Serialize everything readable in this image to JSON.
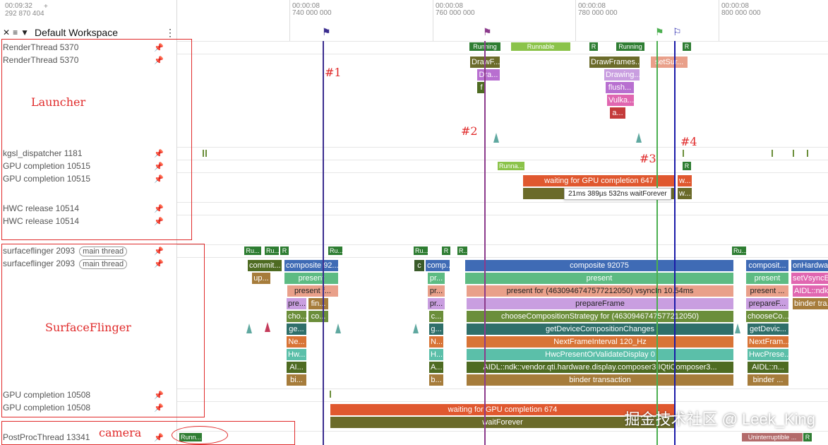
{
  "header": {
    "time": "00:09:32",
    "plus": "+",
    "ns": "292 870 404",
    "workspace_title": "Default Workspace",
    "ruler": [
      {
        "t": "00:00:08",
        "ns": "740 000 000"
      },
      {
        "t": "00:00:08",
        "ns": "760 000 000"
      },
      {
        "t": "00:00:08",
        "ns": "780 000 000"
      },
      {
        "t": "00:00:08",
        "ns": "800 000 000"
      }
    ]
  },
  "tracks": {
    "t0": "RenderThread 5370",
    "t1": "RenderThread 5370",
    "t2": "kgsl_dispatcher 1181",
    "t3": "GPU completion 10515",
    "t4": "GPU completion 10515",
    "t5": "HWC release 10514",
    "t6": "HWC release 10514",
    "t7": "surfaceflinger 2093",
    "t7pill": "main thread",
    "t8": "surfaceflinger 2093",
    "t8pill": "main thread",
    "t9": "GPU completion 10508",
    "t10": "GPU completion 10508",
    "t11": "PostProcThread 13341"
  },
  "annotations": {
    "launcher": "Launcher",
    "surfaceflinger": "SurfaceFlinger",
    "camera": "camera",
    "m1": "#1",
    "m2": "#2",
    "m3": "#3",
    "m4": "#4"
  },
  "slices": {
    "rt_running1": "Running",
    "rt_runnable": "Runnable",
    "rt_r1": "R",
    "rt_running2": "Running",
    "rt_r2": "R",
    "rt_drawf": "DrawF...",
    "rt_dra": "Dra...",
    "rt_f": "f",
    "rt_drawframes": "DrawFrames...",
    "rt_setsur": "setSur...",
    "rt_drawing": "Drawing...",
    "rt_flush": "flush...",
    "rt_vulka": "Vulka...",
    "rt_a": "a...",
    "gpu_runna": "Runna...",
    "gpu_r": "R",
    "gpu_wait647": "waiting for GPU completion 647",
    "gpu_w1": "w...",
    "gpu_w2": "w...",
    "tooltip": "21ms 389µs 532ns waitForever",
    "sf_ru1": "Ru...",
    "sf_ru2": "Ru...",
    "sf_r1": "R",
    "sf_ru3": "Ru...",
    "sf_ru4": "Ru...",
    "sf_r2": "R",
    "sf_r3": "R...",
    "sf_ru5": "Ru...",
    "sf_commit": "commit...",
    "sf_composite1": "composite 92...",
    "sf_c": "c",
    "sf_comp": "comp...",
    "sf_composite_main": "composite 92075",
    "sf_composite2": "composit...",
    "sf_onhardware": "onHardwa...",
    "sf_up": "up...",
    "sf_present1": "present",
    "sf_pr1": "pr...",
    "sf_present_main": "present",
    "sf_present2": "present",
    "sf_setvsync": "setVsyncE...",
    "sf_presentf": "present f...",
    "sf_pr2": "pr...",
    "sf_presentfor": "present for  (4630946747577212050) vsyncIn 10.54ms",
    "sf_present3": "present ...",
    "sf_aidlndk": "AIDL::ndk...",
    "sf_pre": "pre...",
    "sf_fin": "fin...",
    "sf_pr3": "pr...",
    "sf_prepareframe": "prepareFrame",
    "sf_preparef": "prepareF...",
    "sf_bindertra": "binder tra...",
    "sf_cho": "cho...",
    "sf_co": "co...",
    "sf_c2": "c...",
    "sf_choose": "chooseCompositionStrategy for  (4630946747577212050)",
    "sf_chooseco": "chooseCo...",
    "sf_ge": "ge...",
    "sf_g": "g...",
    "sf_getdev": "getDeviceCompositionChanges",
    "sf_getdevic": "getDevic...",
    "sf_ne": "Ne...",
    "sf_n": "N...",
    "sf_nextframe": "NextFrameInterval 120_Hz",
    "sf_nextfram": "NextFram...",
    "sf_hw": "Hw...",
    "sf_h": "H...",
    "sf_hwcpresent": "HwcPresentOrValidateDisplay 0",
    "sf_hwcprese": "HwcPrese...",
    "sf_ai": "AI...",
    "sf_a": "A...",
    "sf_aidlfull": "AIDL::ndk::vendor.qti.hardware.display.composer3.IQtiComposer3...",
    "sf_aidln": "AIDL::n...",
    "sf_bi": "bi...",
    "sf_b": "b...",
    "sf_binder": "binder transaction",
    "sf_binder2": "binder ...",
    "g8_wait674": "waiting for GPU completion 674",
    "g8_waitforever": "waitForever",
    "pp_runn": "Runn...",
    "pp_uninterruptible": "Uninterruptible ...",
    "pp_r": "R"
  },
  "watermark": "掘金技术社区 @ Leek_King",
  "colors": {
    "running": "#2e7d32",
    "runnable": "#8bc34a",
    "waiting": "#e0582f",
    "wait_dark": "#6b6b2a",
    "composite": "#3f6bb5",
    "present": "#5dbb83",
    "presentfor": "#e9a08a",
    "prepare": "#c99ee0",
    "choose": "#6b8e3a",
    "getdevice": "#2f6f6a",
    "nextframe": "#d87436",
    "hwcpresent": "#5bbfa9",
    "aidl": "#4e6b22",
    "binder": "#a67c3b",
    "marker1": "#3b2d8f",
    "marker2": "#8c3b8c",
    "marker3": "#4caf50",
    "marker4": "#1a1aa8",
    "annotation": "#e02a2a"
  }
}
